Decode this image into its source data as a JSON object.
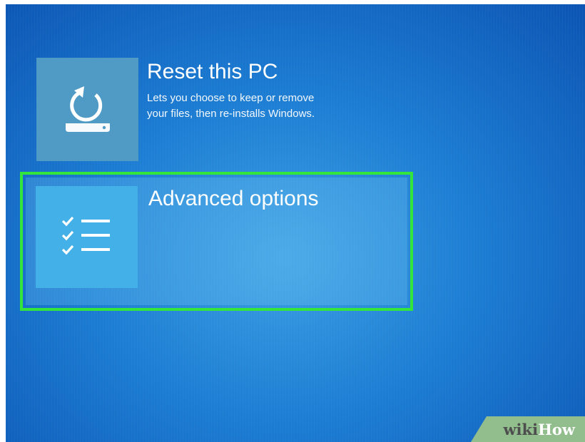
{
  "options": {
    "reset": {
      "title": "Reset this PC",
      "description_line1": "Lets you choose to keep or remove",
      "description_line2": "your files, then re-installs Windows.",
      "icon": "reset-pc-icon"
    },
    "advanced": {
      "title": "Advanced options",
      "icon": "checklist-icon",
      "highlighted": true
    }
  },
  "watermark": {
    "part1": "wiki",
    "part2": "How"
  },
  "colors": {
    "background": "#1c7dd3",
    "tile_reset": "#4f9bc6",
    "tile_advanced": "#44b0e8",
    "highlight_border": "#34e63c"
  }
}
